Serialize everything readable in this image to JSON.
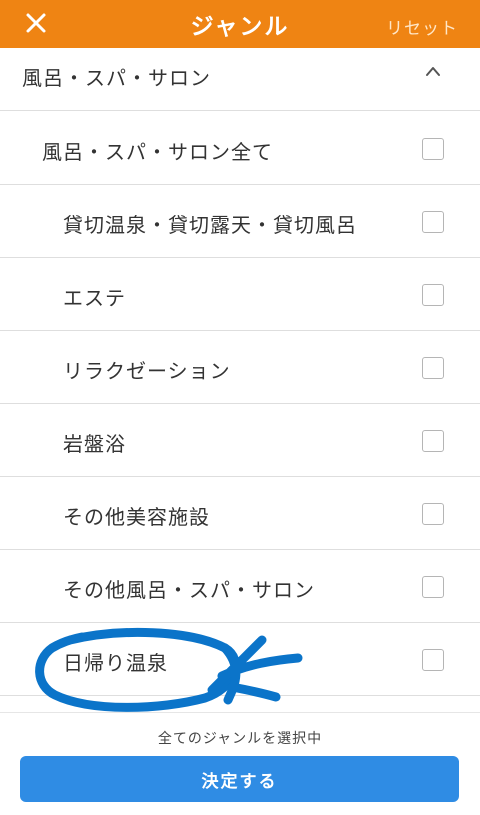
{
  "header": {
    "title": "ジャンル",
    "reset_label": "リセット",
    "accent_color": "#ef8413"
  },
  "section": {
    "label": "風呂・スパ・サロン",
    "expanded": true
  },
  "items": [
    {
      "label": "風呂・スパ・サロン全て",
      "checked": false
    },
    {
      "label": "貸切温泉・貸切露天・貸切風呂",
      "checked": false
    },
    {
      "label": "エステ",
      "checked": false
    },
    {
      "label": "リラクゼーション",
      "checked": false
    },
    {
      "label": "岩盤浴",
      "checked": false
    },
    {
      "label": "その他美容施設",
      "checked": false
    },
    {
      "label": "その他風呂・スパ・サロン",
      "checked": false
    },
    {
      "label": "日帰り温泉",
      "checked": false
    }
  ],
  "footer": {
    "status": "全てのジャンルを選択中",
    "submit_label": "決定する",
    "submit_color": "#2f8ce4"
  },
  "annotation_color": "#0b74c9"
}
